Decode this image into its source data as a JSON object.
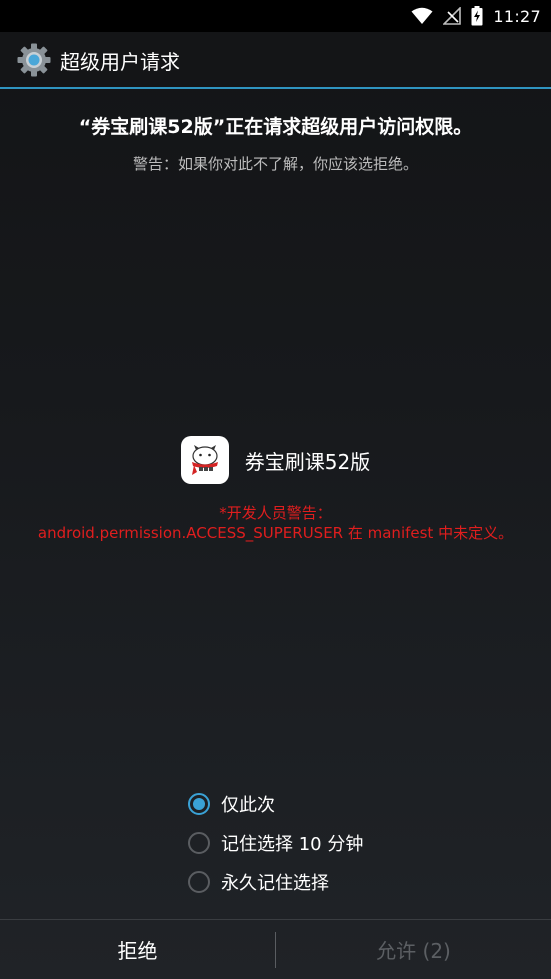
{
  "status_bar": {
    "time": "11:27",
    "icons": [
      "wifi-icon",
      "no-signal-icon",
      "battery-charging-icon"
    ]
  },
  "action_bar": {
    "title": "超级用户请求",
    "icon": "settings-gear-icon"
  },
  "request": {
    "headline": "“券宝刷课52版”正在请求超级用户访问权限。",
    "warning": "警告：如果你对此不了解，你应该选拒绝。"
  },
  "app": {
    "name": "券宝刷课52版",
    "icon": "app-icon"
  },
  "developer_warning": {
    "line1": "*开发人员警告：",
    "line2": "android.permission.ACCESS_SUPERUSER 在 manifest 中未定义。"
  },
  "options": [
    {
      "label": "仅此次",
      "checked": true
    },
    {
      "label": "记住选择 10 分钟",
      "checked": false
    },
    {
      "label": "永久记住选择",
      "checked": false
    }
  ],
  "buttons": {
    "deny": "拒绝",
    "allow": "允许 (2)"
  },
  "colors": {
    "accent": "#3aa2d6",
    "warning_red": "#e01e1e",
    "divider_blue": "#2f94c0"
  }
}
